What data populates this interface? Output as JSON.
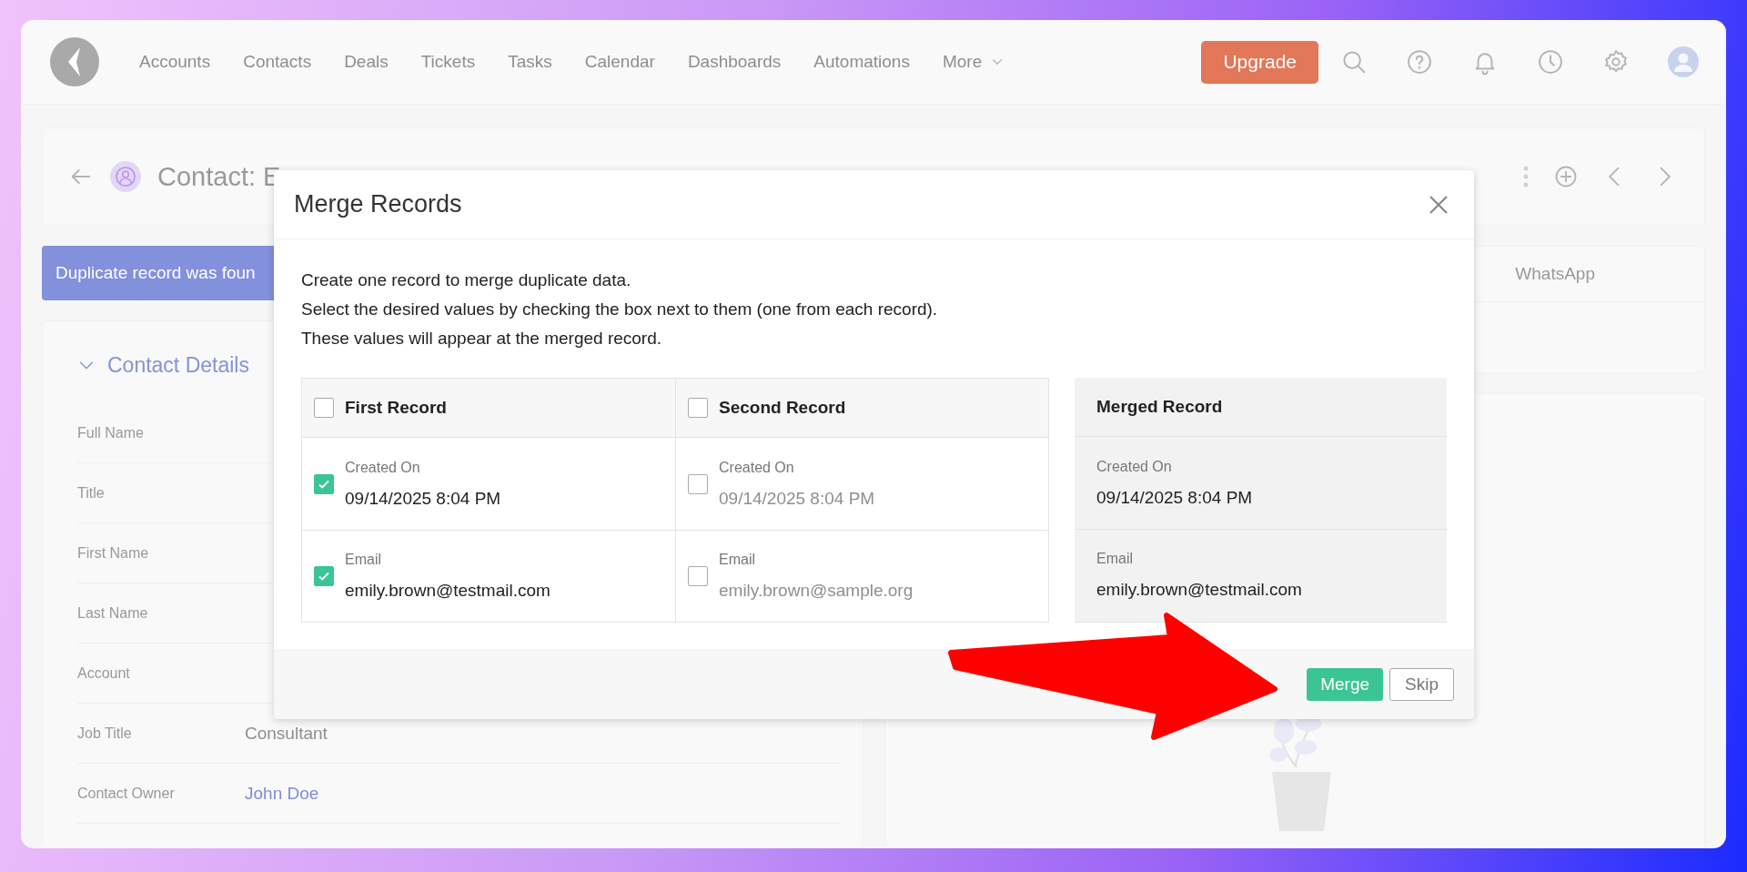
{
  "nav": {
    "items": [
      "Accounts",
      "Contacts",
      "Deals",
      "Tickets",
      "Tasks",
      "Calendar",
      "Dashboards",
      "Automations"
    ],
    "more": "More",
    "upgrade": "Upgrade"
  },
  "page_header": {
    "title": "Contact: E"
  },
  "banner": "Duplicate record was foun",
  "details": {
    "title": "Contact Details",
    "expanded": true,
    "fields": [
      {
        "label": "Full Name"
      },
      {
        "label": "Title"
      },
      {
        "label": "First Name"
      },
      {
        "label": "Last Name"
      },
      {
        "label": "Account"
      },
      {
        "label": "Job Title",
        "value": "Consultant",
        "kind": "text"
      },
      {
        "label": "Contact Owner",
        "value": "John Doe",
        "kind": "link"
      }
    ]
  },
  "channel_tab": "WhatsApp",
  "modal": {
    "title": "Merge Records",
    "intro": [
      "Create one record to merge duplicate data.",
      "Select the desired values by checking the box next to them (one from each record).",
      "These values will appear at the merged record."
    ],
    "records": [
      {
        "title": "First Record",
        "checked": false,
        "fields": [
          {
            "label": "Created On",
            "value": "09/14/2025 8:04 PM",
            "checked": true
          },
          {
            "label": "Email",
            "value": "emily.brown@testmail.com",
            "checked": true
          }
        ]
      },
      {
        "title": "Second Record",
        "checked": false,
        "fields": [
          {
            "label": "Created On",
            "value": "09/14/2025 8:04 PM",
            "checked": false
          },
          {
            "label": "Email",
            "value": "emily.brown@sample.org",
            "checked": false
          }
        ]
      }
    ],
    "merged": {
      "title": "Merged Record",
      "fields": [
        {
          "label": "Created On",
          "value": "09/14/2025 8:04 PM"
        },
        {
          "label": "Email",
          "value": "emily.brown@testmail.com"
        }
      ]
    },
    "primary_button": "Merge",
    "secondary_button": "Skip"
  }
}
